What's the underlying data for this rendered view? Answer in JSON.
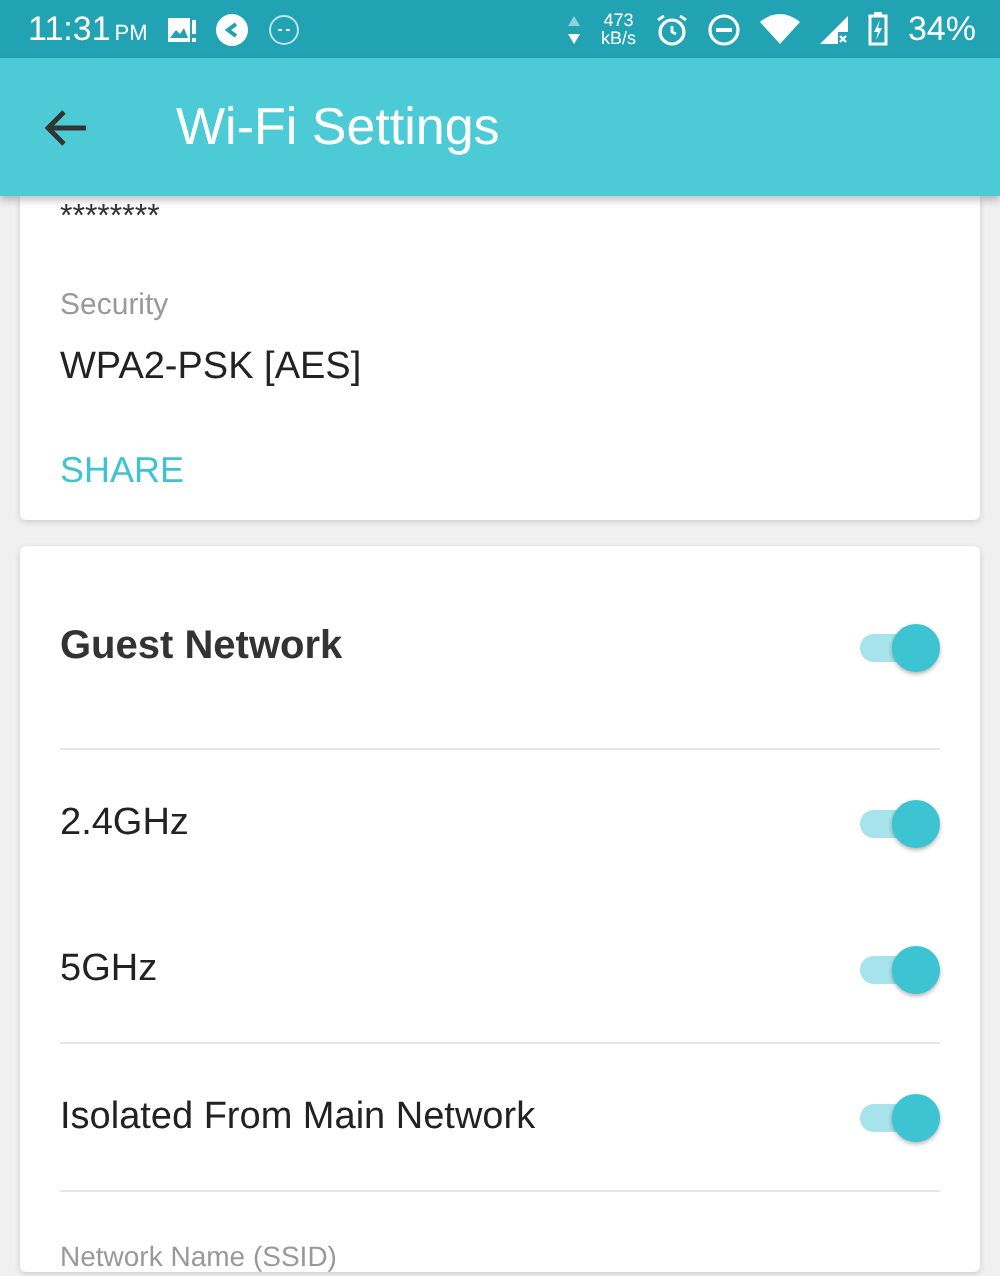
{
  "status_bar": {
    "time": "11:31",
    "ampm": "PM",
    "speed_value": "473",
    "speed_unit": "kB/s",
    "battery": "34%"
  },
  "app_bar": {
    "title": "Wi‑Fi Settings"
  },
  "wifi_card": {
    "password": "********",
    "security_label": "Security",
    "security_value": "WPA2-PSK [AES]",
    "share_button": "SHARE"
  },
  "guest_card": {
    "rows": [
      {
        "kind": "header",
        "label": "Guest Network",
        "on": true
      },
      {
        "kind": "toggle",
        "label": "2.4GHz",
        "on": true
      },
      {
        "kind": "toggle",
        "label": "5GHz",
        "on": true
      },
      {
        "kind": "toggle",
        "label": "Isolated From Main Network",
        "on": true
      },
      {
        "kind": "field",
        "label": "Network Name (SSID)"
      }
    ]
  }
}
